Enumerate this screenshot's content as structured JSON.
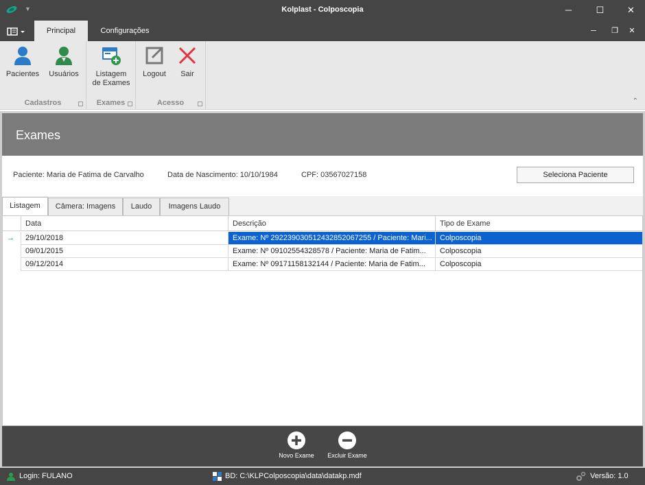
{
  "window": {
    "title": "Kolplast - Colposcopia",
    "minimize": "─",
    "maximize": "☐",
    "close": "✕"
  },
  "ribbon_tabs": [
    {
      "label": "Principal"
    },
    {
      "label": "Configurações"
    }
  ],
  "ribbon_groups": {
    "cadastros": {
      "caption": "Cadastros",
      "buttons": [
        {
          "label": "Pacientes"
        },
        {
          "label": "Usuários"
        }
      ]
    },
    "exames": {
      "caption": "Exames",
      "buttons": [
        {
          "label_line1": "Listagem",
          "label_line2": "de Exames"
        }
      ]
    },
    "acesso": {
      "caption": "Acesso",
      "buttons": [
        {
          "label": "Logout"
        },
        {
          "label": "Sair"
        }
      ]
    }
  },
  "panel": {
    "title": "Exames"
  },
  "patient_info": {
    "name": "Paciente: Maria de Fatima de Carvalho",
    "birth": "Data de Nascimento: 10/10/1984",
    "cpf": "CPF: 03567027158",
    "select_button": "Seleciona Paciente"
  },
  "content_tabs": [
    {
      "label": "Listagem"
    },
    {
      "label": "Câmera: Imagens"
    },
    {
      "label": "Laudo"
    },
    {
      "label": "Imagens Laudo"
    }
  ],
  "grid": {
    "columns": [
      "Data",
      "Descrição",
      "Tipo de Exame"
    ],
    "indicator": "→",
    "rows": [
      {
        "data": "29/10/2018",
        "descricao": "Exame: Nº 29223903051243285206725​5 / Paciente: Mari...",
        "tipo": "Colposcopia"
      },
      {
        "data": "09/01/2015",
        "descricao": "Exame: Nº 09102554328578  /  Paciente: Maria de Fatim...",
        "tipo": "Colposcopia"
      },
      {
        "data": "09/12/2014",
        "descricao": "Exame: Nº 09171158132144  /  Paciente: Maria de Fatim...",
        "tipo": "Colposcopia"
      }
    ]
  },
  "footer_buttons": {
    "novo": "Novo Exame",
    "excluir": "Excluir Exame"
  },
  "statusbar": {
    "login": "Login: FULANO",
    "db": "BD: C:\\KLPColposcopia\\data\\datakp.mdf",
    "version": "Versão: 1.0"
  }
}
